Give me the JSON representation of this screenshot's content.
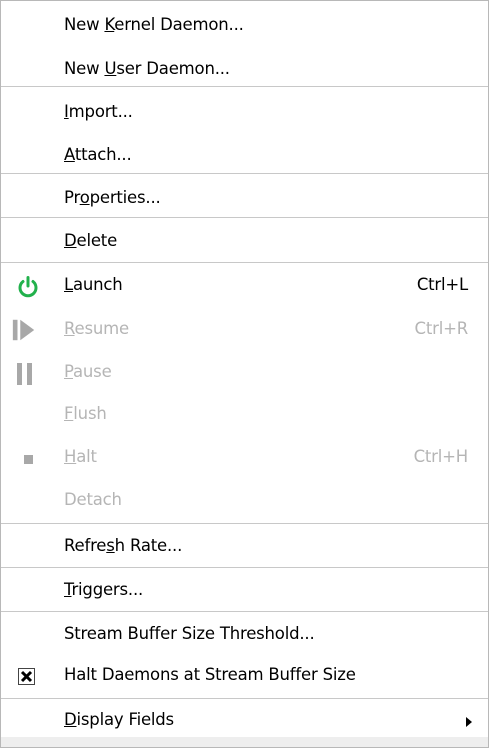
{
  "menu": {
    "items": {
      "new_kernel_daemon": {
        "pre": "New ",
        "mn": "K",
        "post": "ernel Daemon..."
      },
      "new_user_daemon": {
        "pre": "New ",
        "mn": "U",
        "post": "ser Daemon..."
      },
      "import": {
        "pre": "",
        "mn": "I",
        "post": "mport..."
      },
      "attach": {
        "pre": "",
        "mn": "A",
        "post": "ttach..."
      },
      "properties": {
        "pre": "Pr",
        "mn": "o",
        "post": "perties..."
      },
      "delete": {
        "pre": "",
        "mn": "D",
        "post": "elete"
      },
      "launch": {
        "pre": "",
        "mn": "L",
        "post": "aunch",
        "accel": "Ctrl+L",
        "icon": "power-icon",
        "icon_color": "#22b14c"
      },
      "resume": {
        "pre": "",
        "mn": "R",
        "post": "esume",
        "accel": "Ctrl+R",
        "icon": "resume-icon",
        "disabled": true
      },
      "pause": {
        "pre": "",
        "mn": "P",
        "post": "ause",
        "icon": "pause-icon",
        "disabled": true
      },
      "flush": {
        "pre": "",
        "mn": "F",
        "post": "lush",
        "disabled": true
      },
      "halt": {
        "pre": "",
        "mn": "H",
        "post": "alt",
        "accel": "Ctrl+H",
        "icon": "stop-icon",
        "disabled": true
      },
      "detach": {
        "pre": "Detach",
        "mn": "",
        "post": "",
        "disabled": true
      },
      "refresh_rate": {
        "pre": "Refre",
        "mn": "s",
        "post": "h Rate..."
      },
      "triggers": {
        "pre": "",
        "mn": "T",
        "post": "riggers..."
      },
      "stream_buffer_threshold": {
        "pre": "Stream Buffer Size Threshold...",
        "mn": "",
        "post": ""
      },
      "halt_daemons_at_buffer": {
        "pre": "Halt Daemons at Stream Buffer Size",
        "mn": "",
        "post": "",
        "checked": true
      },
      "display_fields": {
        "pre": "",
        "mn": "D",
        "post": "isplay Fields",
        "submenu": true
      }
    }
  },
  "colors": {
    "disabled_text": "#b5b5b5",
    "disabled_icon": "#a8a8a8",
    "separator": "#c8c8c8",
    "launch_icon": "#22b14c"
  }
}
